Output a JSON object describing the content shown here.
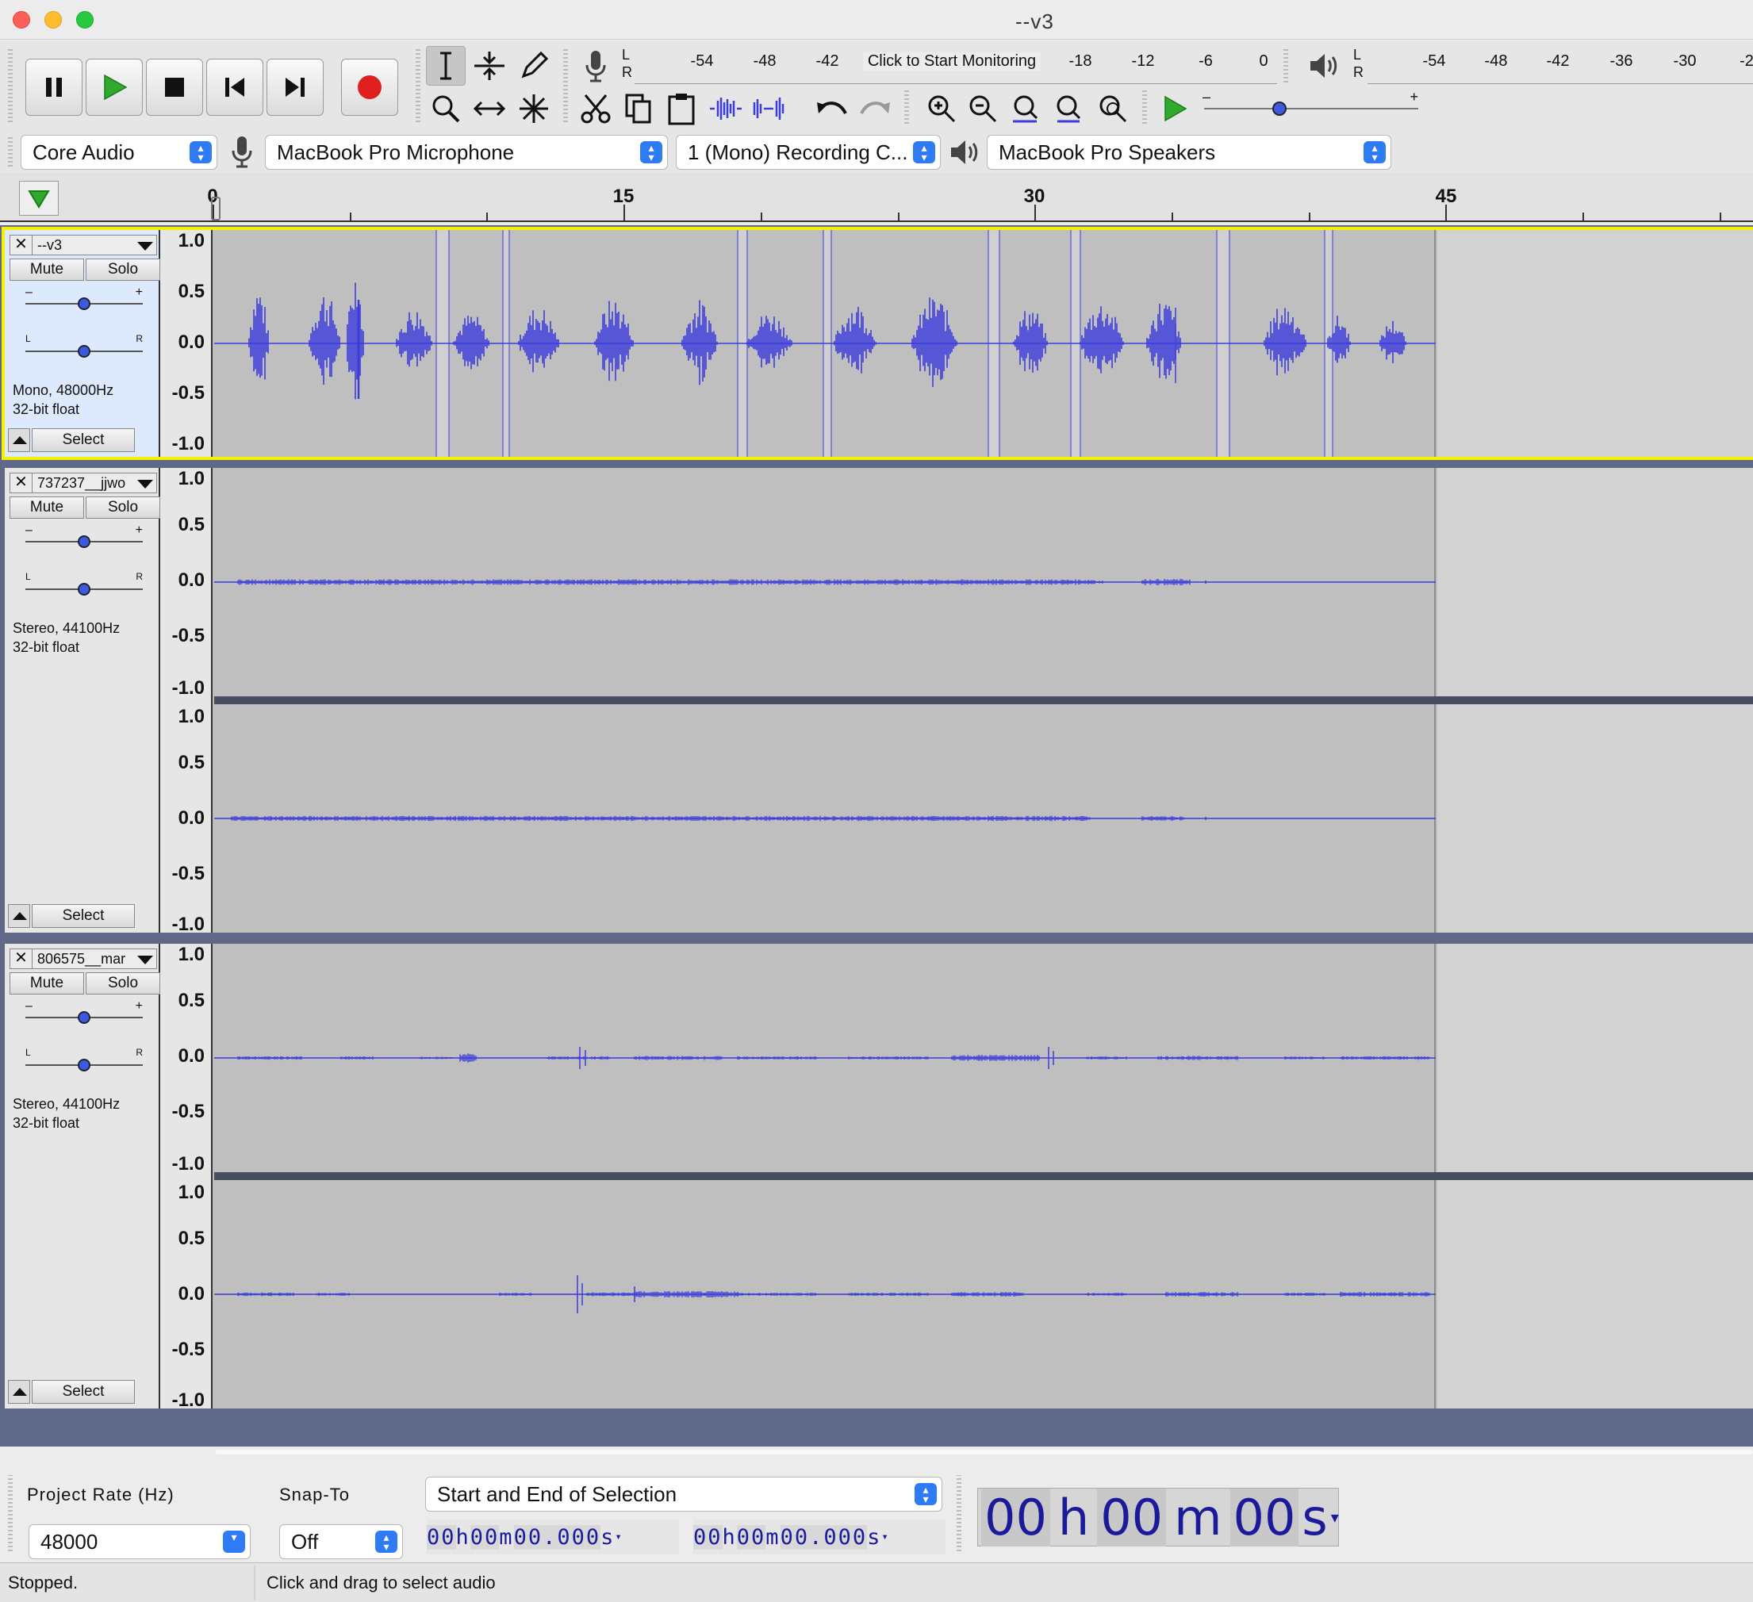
{
  "window": {
    "title": "--v3"
  },
  "transport": {
    "buttons": [
      {
        "name": "pause-button",
        "icon": "pause-icon"
      },
      {
        "name": "play-button",
        "icon": "play-icon"
      },
      {
        "name": "stop-button",
        "icon": "stop-icon"
      },
      {
        "name": "skip-start-button",
        "icon": "skip-to-start-icon"
      },
      {
        "name": "skip-end-button",
        "icon": "skip-to-end-icon"
      },
      {
        "name": "record-button",
        "icon": "record-icon"
      }
    ]
  },
  "tools": {
    "row1": [
      "selection-tool-icon",
      "envelope-tool-icon",
      "draw-tool-icon"
    ],
    "row2": [
      "zoom-tool-icon",
      "time-shift-tool-icon",
      "multi-tool-icon"
    ],
    "selected": "selection-tool-icon"
  },
  "record_meter": {
    "lr": [
      "L",
      "R"
    ],
    "ticks": [
      "-54",
      "-48",
      "-42",
      "-18",
      "-12",
      "-6",
      "0"
    ],
    "monitor_label": "Click to Start Monitoring"
  },
  "playback_meter": {
    "lr": [
      "L",
      "R"
    ],
    "ticks": [
      "-54",
      "-48",
      "-42",
      "-36",
      "-30",
      "-2"
    ]
  },
  "edit_tools": [
    "cut-icon",
    "copy-icon",
    "paste-icon",
    "trim-icon",
    "silence-icon",
    "undo-icon",
    "redo-icon",
    "zoom-in-icon",
    "zoom-out-icon",
    "fit-selection-icon",
    "fit-project-icon",
    "zoom-toggle-icon"
  ],
  "play_at_speed": {
    "minus": "–",
    "plus": "+",
    "speed_fraction": 0.34
  },
  "device": {
    "host": "Core Audio",
    "input": "MacBook Pro Microphone",
    "channels": "1 (Mono) Recording C...",
    "output": "MacBook Pro Speakers"
  },
  "ruler": {
    "labels": [
      "0",
      "15",
      "30",
      "45"
    ]
  },
  "tracks": [
    {
      "name": "--v3",
      "mute": "Mute",
      "solo": "Solo",
      "gain_minus": "–",
      "gain_plus": "+",
      "pan_l": "L",
      "pan_r": "R",
      "gain": 0.5,
      "pan": 0.5,
      "info1": "Mono, 48000Hz",
      "info2": "32-bit float",
      "select": "Select",
      "scale": [
        "1.0",
        "0.5",
        "0.0",
        "-0.5",
        "-1.0"
      ],
      "selected": true
    },
    {
      "name": "737237__jjwo",
      "mute": "Mute",
      "solo": "Solo",
      "gain_minus": "–",
      "gain_plus": "+",
      "pan_l": "L",
      "pan_r": "R",
      "gain": 0.5,
      "pan": 0.5,
      "info1": "Stereo, 44100Hz",
      "info2": "32-bit float",
      "select": "Select",
      "scale": [
        "1.0",
        "0.5",
        "0.0",
        "-0.5",
        "-1.0"
      ],
      "scale2": [
        "1.0",
        "0.5",
        "0.0",
        "-0.5",
        "-1.0"
      ]
    },
    {
      "name": "806575__mar",
      "mute": "Mute",
      "solo": "Solo",
      "gain_minus": "–",
      "gain_plus": "+",
      "pan_l": "L",
      "pan_r": "R",
      "gain": 0.5,
      "pan": 0.5,
      "info1": "Stereo, 44100Hz",
      "info2": "32-bit float",
      "select": "Select",
      "scale": [
        "1.0",
        "0.5",
        "0.0",
        "-0.5",
        "-1.0"
      ],
      "scale2": [
        "1.0",
        "0.5",
        "0.0",
        "-0.5",
        "-1.0"
      ]
    }
  ],
  "bottom": {
    "project_rate_label": "Project Rate (Hz)",
    "project_rate": "48000",
    "snap_label": "Snap-To",
    "snap": "Off",
    "selection_mode": "Start and End of Selection",
    "sel_start": {
      "h": "00",
      "m": "00",
      "s": "00.000",
      "hl": "h",
      "ml": "m",
      "sl": "s"
    },
    "sel_end": {
      "h": "00",
      "m": "00",
      "s": "00.000",
      "hl": "h",
      "ml": "m",
      "sl": "s"
    },
    "audio_pos": {
      "h": "00",
      "m": "00",
      "s": "00",
      "hl": "h",
      "ml": "m",
      "sl": "s"
    }
  },
  "status": {
    "state": "Stopped.",
    "hint": "Click and drag to select audio"
  },
  "colors": {
    "waveform": "#3c3cdc",
    "selected_track_border": "#f2f200",
    "record": "#e0201c",
    "play": "#2faa2f",
    "accent": "#2f7bf5"
  }
}
